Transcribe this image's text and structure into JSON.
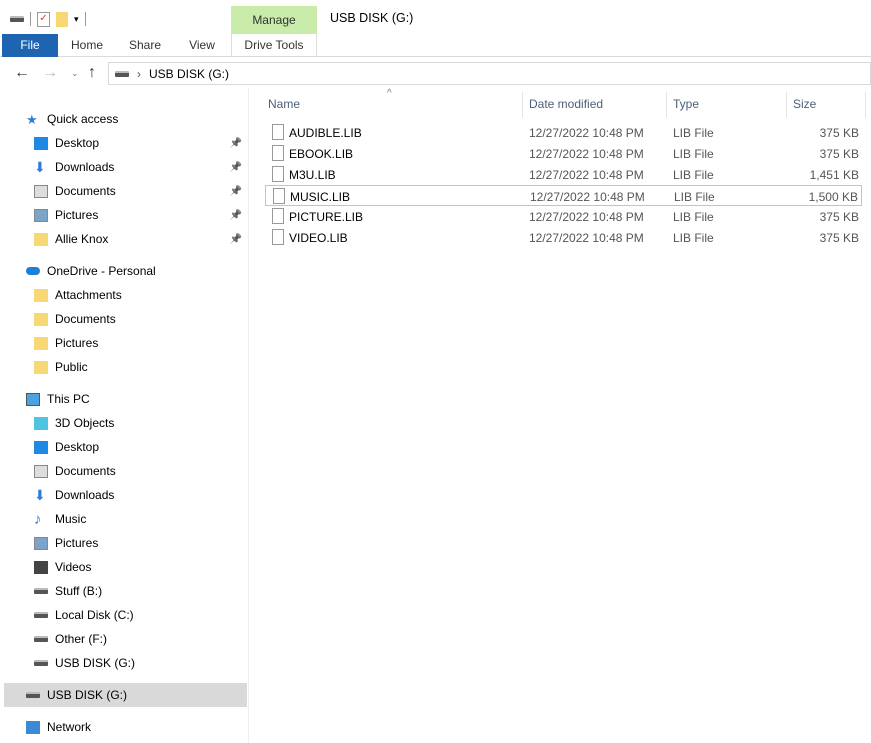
{
  "window": {
    "title": "USB DISK (G:)"
  },
  "ribbon": {
    "context_group": "Manage",
    "tabs": [
      "File",
      "Home",
      "Share",
      "View",
      "Drive Tools"
    ]
  },
  "address": {
    "path": "USB DISK (G:)"
  },
  "sidebar": {
    "quick_access": {
      "label": "Quick access",
      "items": [
        {
          "label": "Desktop",
          "icon": "desktop-icon",
          "color": "#1e88e5"
        },
        {
          "label": "Downloads",
          "icon": "download-icon",
          "color": "#2f7bd6"
        },
        {
          "label": "Documents",
          "icon": "document-icon",
          "color": "#ddd"
        },
        {
          "label": "Pictures",
          "icon": "pictures-icon",
          "color": "#7aa4c8"
        },
        {
          "label": "Allie Knox",
          "icon": "folder-icon",
          "color": "#f8d775"
        }
      ]
    },
    "onedrive": {
      "label": "OneDrive - Personal",
      "items": [
        {
          "label": "Attachments"
        },
        {
          "label": "Documents"
        },
        {
          "label": "Pictures"
        },
        {
          "label": "Public"
        }
      ]
    },
    "this_pc": {
      "label": "This PC",
      "items": [
        {
          "label": "3D Objects",
          "icon": "cube-icon",
          "color": "#4fc3e0"
        },
        {
          "label": "Desktop",
          "icon": "desktop-icon",
          "color": "#1e88e5"
        },
        {
          "label": "Documents",
          "icon": "document-icon",
          "color": "#ddd"
        },
        {
          "label": "Downloads",
          "icon": "download-icon",
          "color": "#2f7bd6"
        },
        {
          "label": "Music",
          "icon": "music-icon",
          "color": "#2f7bd6"
        },
        {
          "label": "Pictures",
          "icon": "pictures-icon",
          "color": "#7aa4c8"
        },
        {
          "label": "Videos",
          "icon": "video-icon",
          "color": "#444"
        },
        {
          "label": "Stuff (B:)",
          "icon": "drive-icon",
          "color": "#555"
        },
        {
          "label": "Local Disk (C:)",
          "icon": "drive-icon",
          "color": "#555"
        },
        {
          "label": "Other (F:)",
          "icon": "drive-icon",
          "color": "#555"
        },
        {
          "label": "USB DISK (G:)",
          "icon": "drive-icon",
          "color": "#555"
        }
      ]
    },
    "usb": {
      "label": "USB DISK (G:)"
    },
    "network": {
      "label": "Network"
    }
  },
  "columns": {
    "name": "Name",
    "date": "Date modified",
    "type": "Type",
    "size": "Size"
  },
  "files": [
    {
      "name": "AUDIBLE.LIB",
      "date": "12/27/2022 10:48 PM",
      "type": "LIB File",
      "size": "375 KB"
    },
    {
      "name": "EBOOK.LIB",
      "date": "12/27/2022 10:48 PM",
      "type": "LIB File",
      "size": "375 KB"
    },
    {
      "name": "M3U.LIB",
      "date": "12/27/2022 10:48 PM",
      "type": "LIB File",
      "size": "1,451 KB"
    },
    {
      "name": "MUSIC.LIB",
      "date": "12/27/2022 10:48 PM",
      "type": "LIB File",
      "size": "1,500 KB"
    },
    {
      "name": "PICTURE.LIB",
      "date": "12/27/2022 10:48 PM",
      "type": "LIB File",
      "size": "375 KB"
    },
    {
      "name": "VIDEO.LIB",
      "date": "12/27/2022 10:48 PM",
      "type": "LIB File",
      "size": "375 KB"
    }
  ]
}
